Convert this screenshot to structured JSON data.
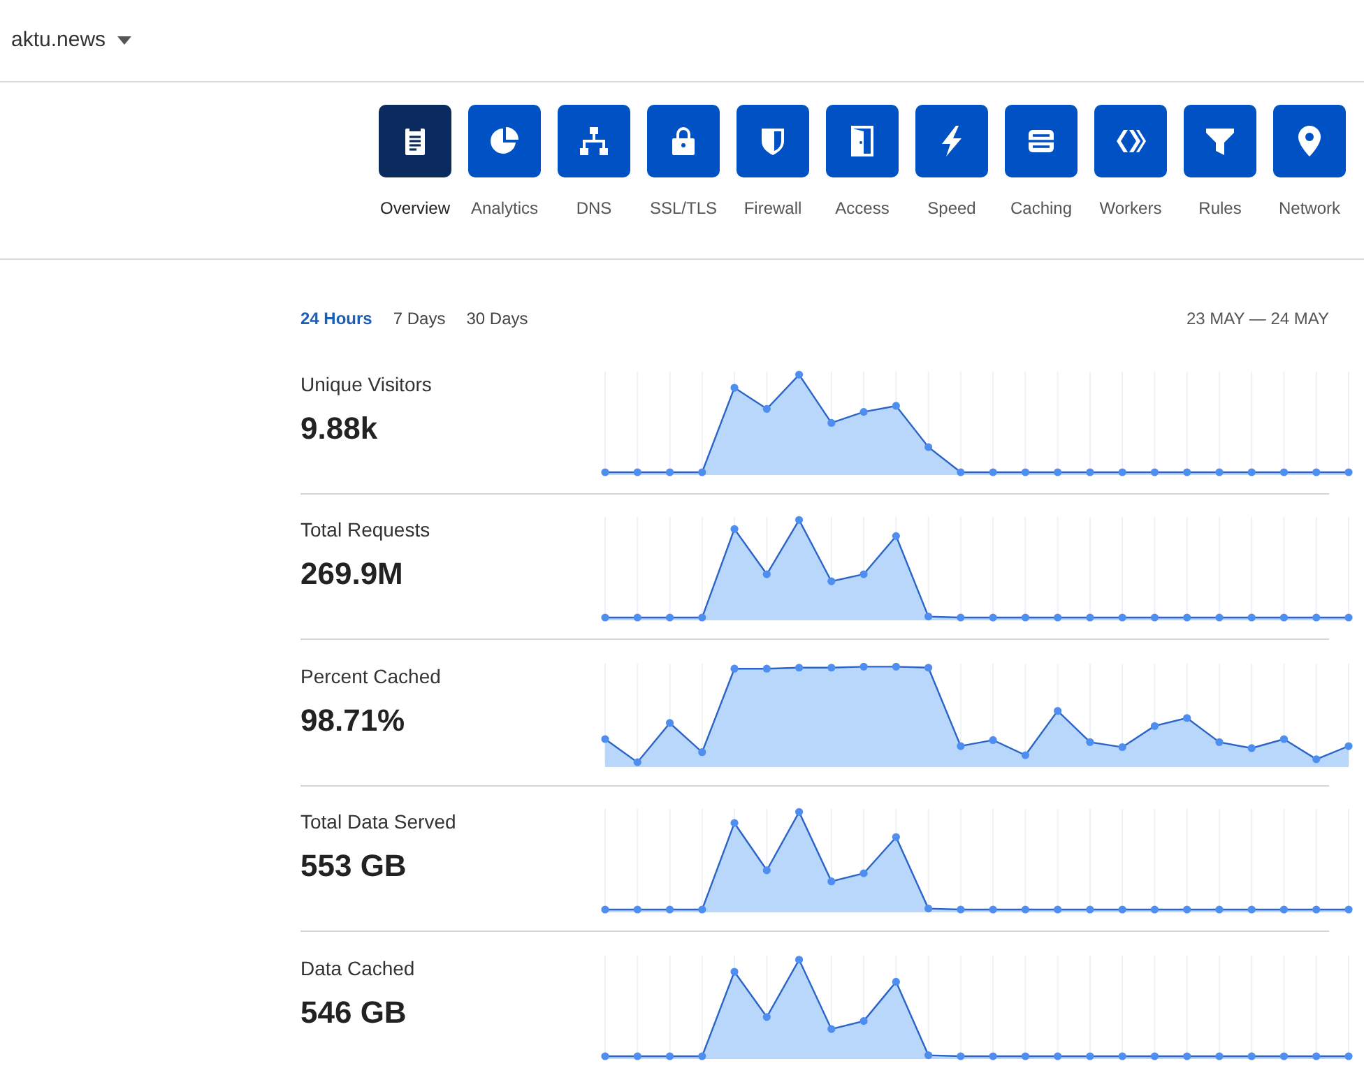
{
  "site": {
    "name": "aktu.news"
  },
  "nav": [
    {
      "label": "Overview",
      "selected": true
    },
    {
      "label": "Analytics",
      "selected": false
    },
    {
      "label": "DNS",
      "selected": false
    },
    {
      "label": "SSL/TLS",
      "selected": false
    },
    {
      "label": "Firewall",
      "selected": false
    },
    {
      "label": "Access",
      "selected": false
    },
    {
      "label": "Speed",
      "selected": false
    },
    {
      "label": "Caching",
      "selected": false
    },
    {
      "label": "Workers",
      "selected": false
    },
    {
      "label": "Rules",
      "selected": false
    },
    {
      "label": "Network",
      "selected": false
    }
  ],
  "ranges": [
    {
      "label": "24 Hours",
      "selected": true
    },
    {
      "label": "7 Days",
      "selected": false
    },
    {
      "label": "30 Days",
      "selected": false
    }
  ],
  "date_range": "23 MAY — 24 MAY",
  "metrics": [
    {
      "label": "Unique Visitors",
      "value": "9.88k"
    },
    {
      "label": "Total Requests",
      "value": "269.9M"
    },
    {
      "label": "Percent Cached",
      "value": "98.71%"
    },
    {
      "label": "Total Data Served",
      "value": "553 GB"
    },
    {
      "label": "Data Cached",
      "value": "546 GB"
    }
  ]
}
